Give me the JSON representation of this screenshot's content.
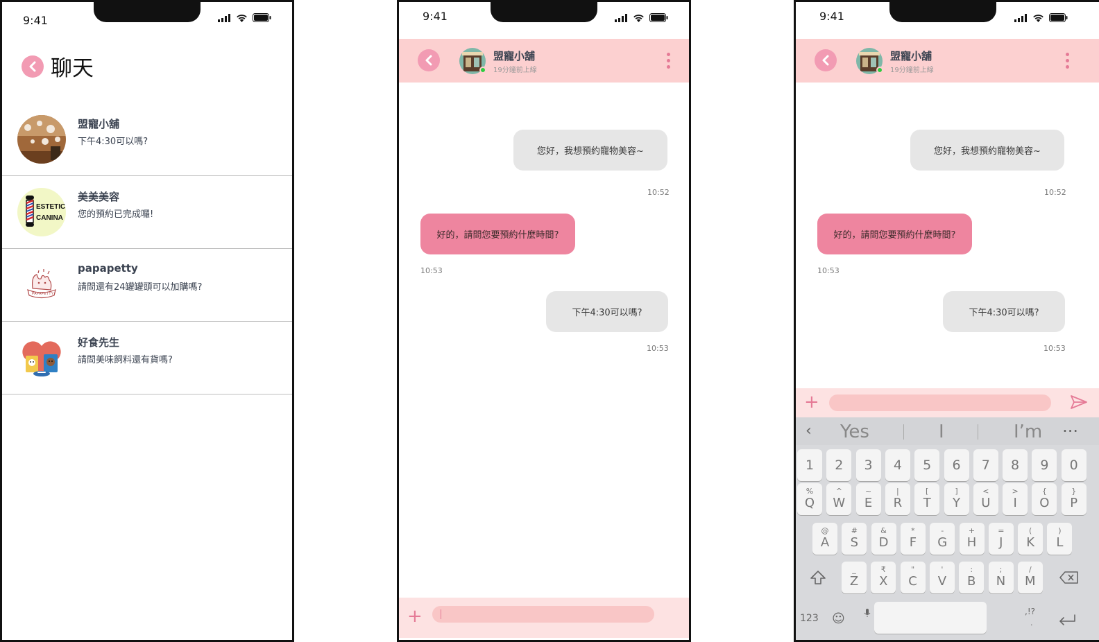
{
  "status": {
    "time_1": "9:41",
    "time_2": "9:41",
    "time_3": "9:41"
  },
  "colors": {
    "accent": "#f29bb3",
    "header_bg": "#fcd0d0",
    "incoming_bubble": "#ee859f",
    "outgoing_bubble": "#e6e6e6",
    "online": "#2ecc40"
  },
  "chat_list": {
    "title": "聊天",
    "items": [
      {
        "name": "盟寵小舖",
        "preview": "下午4:30可以嗎?",
        "avatar": "pet-shop-photo"
      },
      {
        "name": "美美美容",
        "preview": "您的預約已完成囉!",
        "avatar": "barber-pole-logo",
        "logo_text": "ESTETIC CANINA"
      },
      {
        "name": "papapetty",
        "preview": "請問還有24罐罐頭可以加購嗎?",
        "avatar": "pet-paw-logo",
        "logo_text": "PAPAPETTY"
      },
      {
        "name": "好食先生",
        "preview": "請問美味飼料還有貨嗎?",
        "avatar": "pet-food-logo"
      }
    ]
  },
  "chat": {
    "contact_name": "盟寵小舖",
    "last_seen": "19分鐘前上線",
    "messages": [
      {
        "direction": "out",
        "text": "您好，我想預約寵物美容~",
        "time": "10:52"
      },
      {
        "direction": "in",
        "text": "好的，請問您要預約什麼時間?",
        "time": "10:53"
      },
      {
        "direction": "out",
        "text": "下午4:30可以嗎?",
        "time": "10:53"
      }
    ]
  },
  "chat_2": {
    "contact_name": "盟寵小舖",
    "last_seen": "19分鐘前上線",
    "messages": [
      {
        "direction": "out",
        "text": "您好，我想預約寵物美容~",
        "time": "10:52"
      },
      {
        "direction": "in",
        "text": "好的，請問您要預約什麼時間?",
        "time": "10:53"
      },
      {
        "direction": "out",
        "text": "下午4:30可以嗎?",
        "time": "10:53"
      }
    ]
  },
  "composer": {
    "plus_label": "+",
    "plus_label_2": "+"
  },
  "keyboard": {
    "suggestions": [
      "Yes",
      "I",
      "I’m"
    ],
    "number_row": [
      "1",
      "2",
      "3",
      "4",
      "5",
      "6",
      "7",
      "8",
      "9",
      "0"
    ],
    "row1": [
      {
        "pri": "Q",
        "sec": "%"
      },
      {
        "pri": "W",
        "sec": "^"
      },
      {
        "pri": "E",
        "sec": "~"
      },
      {
        "pri": "R",
        "sec": "|"
      },
      {
        "pri": "T",
        "sec": "["
      },
      {
        "pri": "Y",
        "sec": "]"
      },
      {
        "pri": "U",
        "sec": "<"
      },
      {
        "pri": "I",
        "sec": ">"
      },
      {
        "pri": "O",
        "sec": "{"
      },
      {
        "pri": "P",
        "sec": "}"
      }
    ],
    "row2": [
      {
        "pri": "A",
        "sec": "@"
      },
      {
        "pri": "S",
        "sec": "#"
      },
      {
        "pri": "D",
        "sec": "&"
      },
      {
        "pri": "F",
        "sec": "*"
      },
      {
        "pri": "G",
        "sec": "-"
      },
      {
        "pri": "H",
        "sec": "+"
      },
      {
        "pri": "J",
        "sec": "="
      },
      {
        "pri": "K",
        "sec": "("
      },
      {
        "pri": "L",
        "sec": ")"
      }
    ],
    "row3": [
      {
        "pri": "Z",
        "sec": "_"
      },
      {
        "pri": "X",
        "sec": "₹"
      },
      {
        "pri": "C",
        "sec": "\""
      },
      {
        "pri": "V",
        "sec": "'"
      },
      {
        "pri": "B",
        "sec": ":"
      },
      {
        "pri": "N",
        "sec": ";"
      },
      {
        "pri": "M",
        "sec": "/"
      }
    ],
    "mode_label": "123",
    "punct_label": ",!?",
    "punct_sub": "."
  }
}
